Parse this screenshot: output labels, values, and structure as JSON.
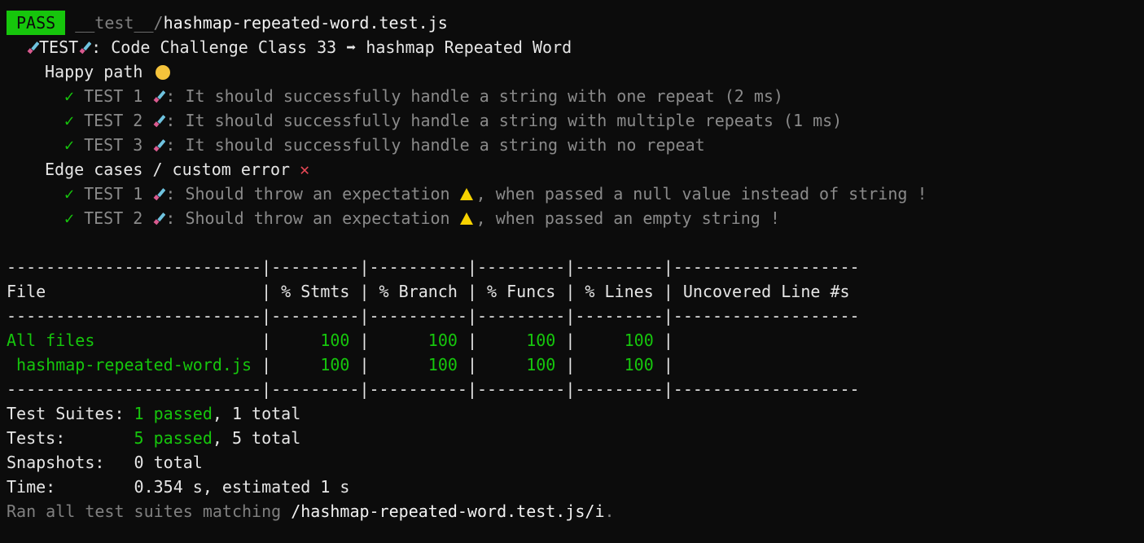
{
  "header": {
    "status": "PASS",
    "path_prefix": "__test__/",
    "file": "hashmap-repeated-word.test.js"
  },
  "suite": {
    "label_pre": "TEST",
    "title": ": Code Challenge Class 33 ➡ hashmap Repeated Word"
  },
  "groups": [
    {
      "name": "Happy path",
      "icon": "grinning-face-icon",
      "tests": [
        {
          "label": "TEST 1",
          "text": ": It should successfully handle a string with one repeat (2 ms)"
        },
        {
          "label": "TEST 2",
          "text": ": It should successfully handle a string with multiple repeats (1 ms)"
        },
        {
          "label": "TEST 3",
          "text": ": It should successfully handle a string with no repeat"
        }
      ]
    },
    {
      "name": "Edge cases / custom error",
      "icon": "cross-mark-icon",
      "tests": [
        {
          "label": "TEST 1",
          "text_a": ": Should throw an expectation ",
          "text_b": ", when passed a null value instead of string !"
        },
        {
          "label": "TEST 2",
          "text_a": ": Should throw an expectation ",
          "text_b": ", when passed an empty string !"
        }
      ]
    }
  ],
  "coverage": {
    "separator": "--------------------------|---------|----------|---------|---------|-------------------",
    "header_row": "File                      | % Stmts | % Branch | % Funcs | % Lines | Uncovered Line #s ",
    "rows": [
      {
        "file": "All files                 ",
        "stmts": "    100",
        "branch": "     100",
        "funcs": "    100",
        "lines": "    100"
      },
      {
        "file": " hashmap-repeated-word.js ",
        "stmts": "    100",
        "branch": "     100",
        "funcs": "    100",
        "lines": "    100"
      }
    ]
  },
  "summary": {
    "suites_label": "Test Suites: ",
    "suites_passed": "1 passed",
    "suites_total": ", 1 total",
    "tests_label": "Tests:       ",
    "tests_passed": "5 passed",
    "tests_total": ", 5 total",
    "snapshots_label": "Snapshots:   ",
    "snapshots_value": "0 total",
    "time_label": "Time:        ",
    "time_value": "0.354 s, estimated 1 s",
    "ran_prefix": "Ran all test suites matching ",
    "ran_pattern": "/hashmap-repeated-word.test.js/i",
    "ran_suffix": "."
  },
  "colors": {
    "pass_green": "#16c60c",
    "error_red": "#e74856",
    "warning_yellow": "#f7d200"
  }
}
